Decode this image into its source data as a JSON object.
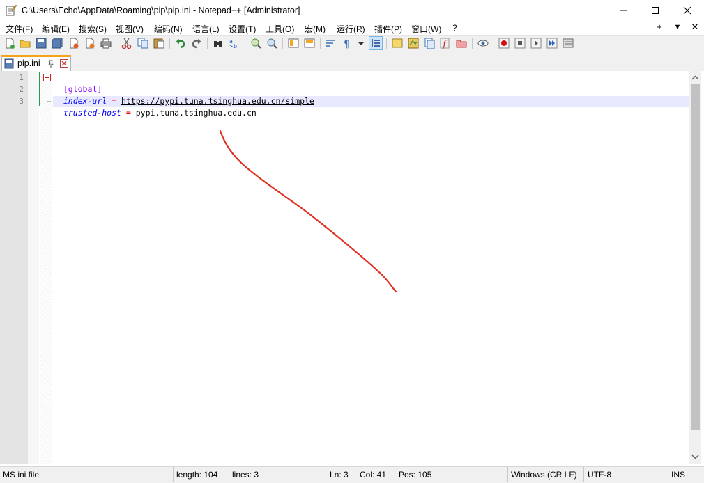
{
  "window": {
    "title": "C:\\Users\\Echo\\AppData\\Roaming\\pip\\pip.ini - Notepad++ [Administrator]",
    "minimize_icon": "minimize-icon",
    "maximize_icon": "maximize-icon",
    "close_icon": "close-icon"
  },
  "menu": {
    "items": [
      "文件(F)",
      "编辑(E)",
      "搜索(S)",
      "视图(V)",
      "编码(N)",
      "语言(L)",
      "设置(T)",
      "工具(O)",
      "宏(M)",
      "运行(R)",
      "插件(P)",
      "窗口(W)",
      "?"
    ],
    "right_controls": [
      "+",
      "▼",
      "✕"
    ]
  },
  "toolbar": {
    "icons": [
      "new-file-icon",
      "open-file-icon",
      "save-icon",
      "save-all-icon",
      "close-icon",
      "close-all-icon",
      "print-icon",
      "cut-icon",
      "copy-icon",
      "paste-icon",
      "undo-icon",
      "redo-icon",
      "find-icon",
      "replace-icon",
      "zoom-in-icon",
      "zoom-out-icon",
      "sync-vertical-icon",
      "sync-horizontal-icon",
      "word-wrap-icon",
      "show-all-chars-icon",
      "indent-guide-icon",
      "user-language-icon",
      "document-map-icon",
      "function-list-icon",
      "folder-as-workspace-icon",
      "monitoring-icon",
      "record-macro-icon",
      "stop-macro-icon",
      "play-macro-icon",
      "run-macro-multiple-icon",
      "save-macro-icon"
    ]
  },
  "tab": {
    "label": "pip.ini"
  },
  "editor": {
    "lines": [
      {
        "num": "1",
        "section": "[global]"
      },
      {
        "num": "2",
        "key": "index-url",
        "eq": " = ",
        "value": "https://pypi.tuna.tsinghua.edu.cn/simple"
      },
      {
        "num": "3",
        "key": "trusted-host",
        "eq": " = ",
        "value": "pypi.tuna.tsinghua.edu.cn"
      }
    ],
    "colors": {
      "section": "#8000ff",
      "key": "#0000ff",
      "accent_line": "#e8e8ff",
      "annotation": "#e03020"
    }
  },
  "status": {
    "file_type": "MS ini file",
    "length": "length: 104",
    "lines": "lines: 3",
    "ln": "Ln: 3",
    "col": "Col: 41",
    "pos": "Pos: 105",
    "eol": "Windows (CR LF)",
    "encoding": "UTF-8",
    "mode": "INS"
  }
}
